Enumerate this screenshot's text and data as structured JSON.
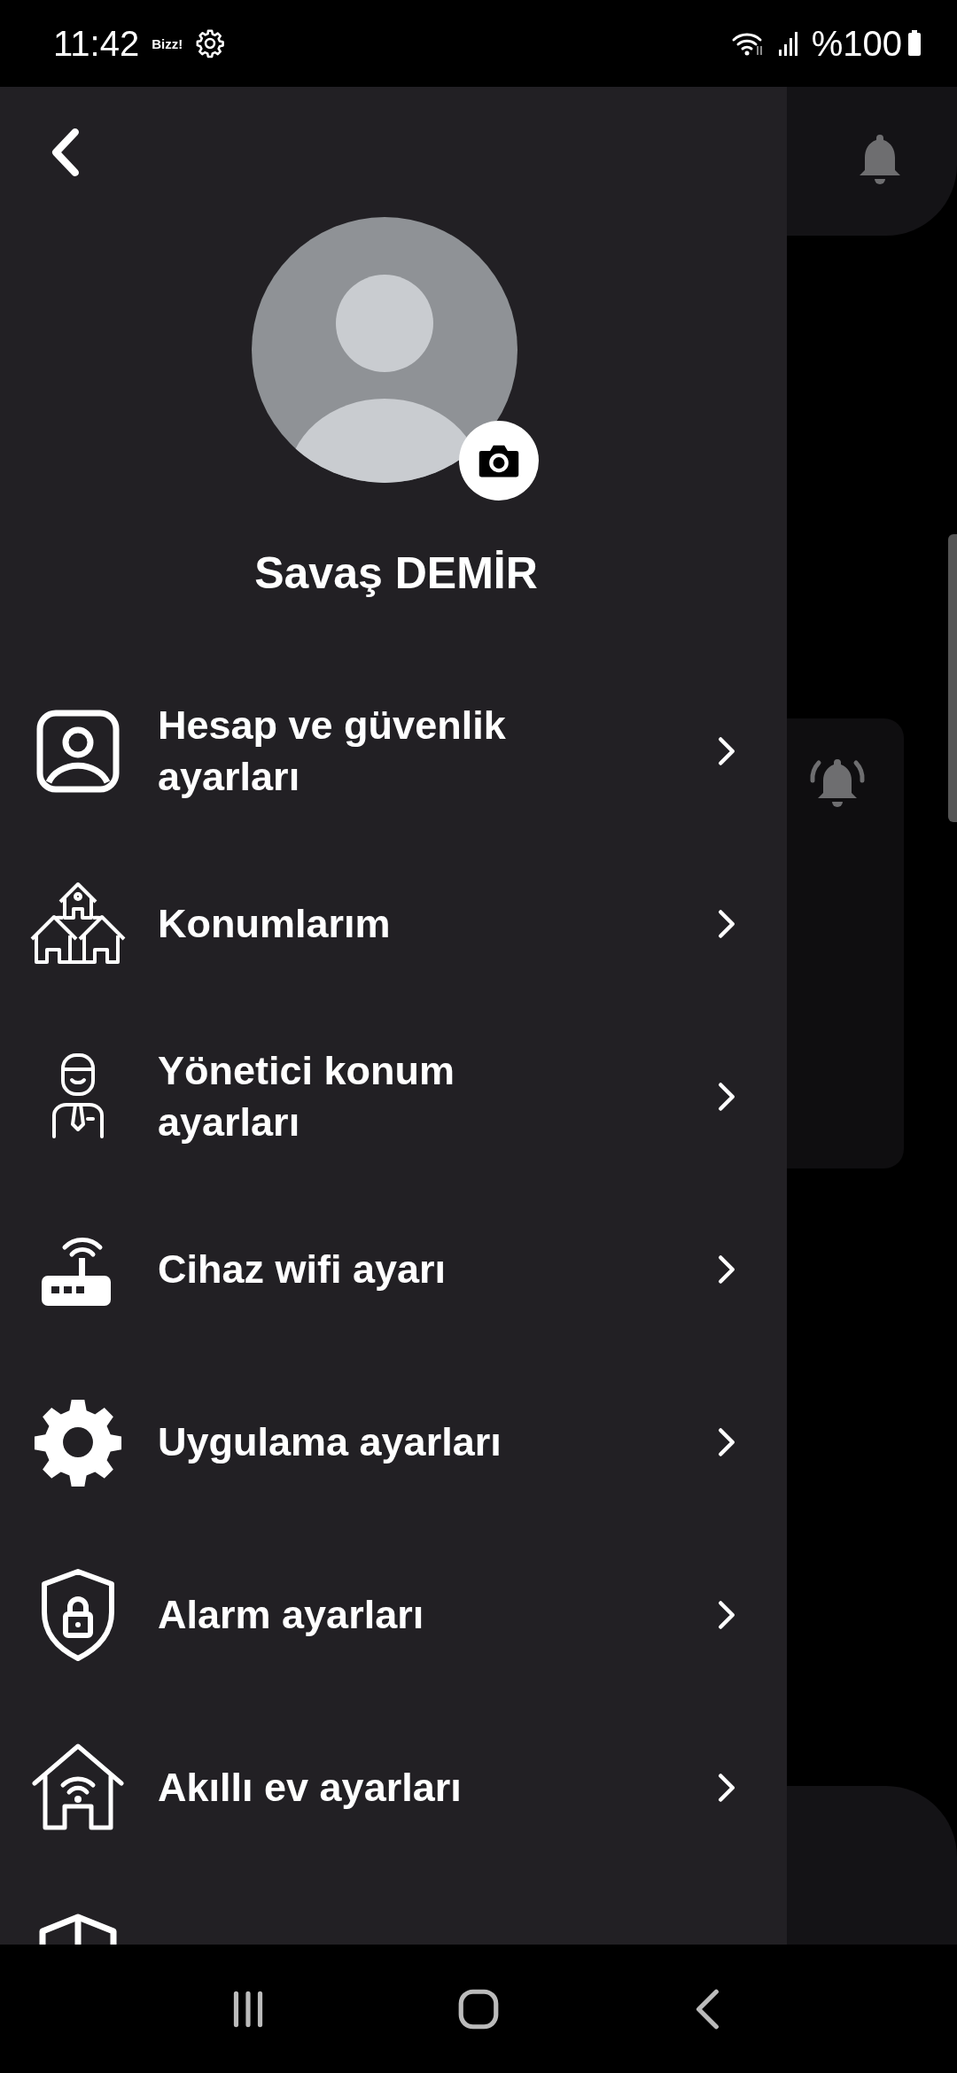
{
  "status_bar": {
    "time": "11:42",
    "app_badge": "Bizz!",
    "battery": "%100"
  },
  "drawer": {
    "profile": {
      "name": "Savaş DEMİR"
    },
    "menu": [
      {
        "kind": "account",
        "label": "Hesap ve güvenlik ayarları"
      },
      {
        "kind": "houses",
        "label": "Konumlarım"
      },
      {
        "kind": "manager",
        "label": "Yönetici konum ayarları"
      },
      {
        "kind": "router",
        "label": "Cihaz wifi ayarı"
      },
      {
        "kind": "gear",
        "label": "Uygulama ayarları"
      },
      {
        "kind": "shield",
        "label": "Alarm ayarları"
      },
      {
        "kind": "smarthome",
        "label": "Akıllı ev ayarları"
      },
      {
        "kind": "cube"
      }
    ]
  }
}
